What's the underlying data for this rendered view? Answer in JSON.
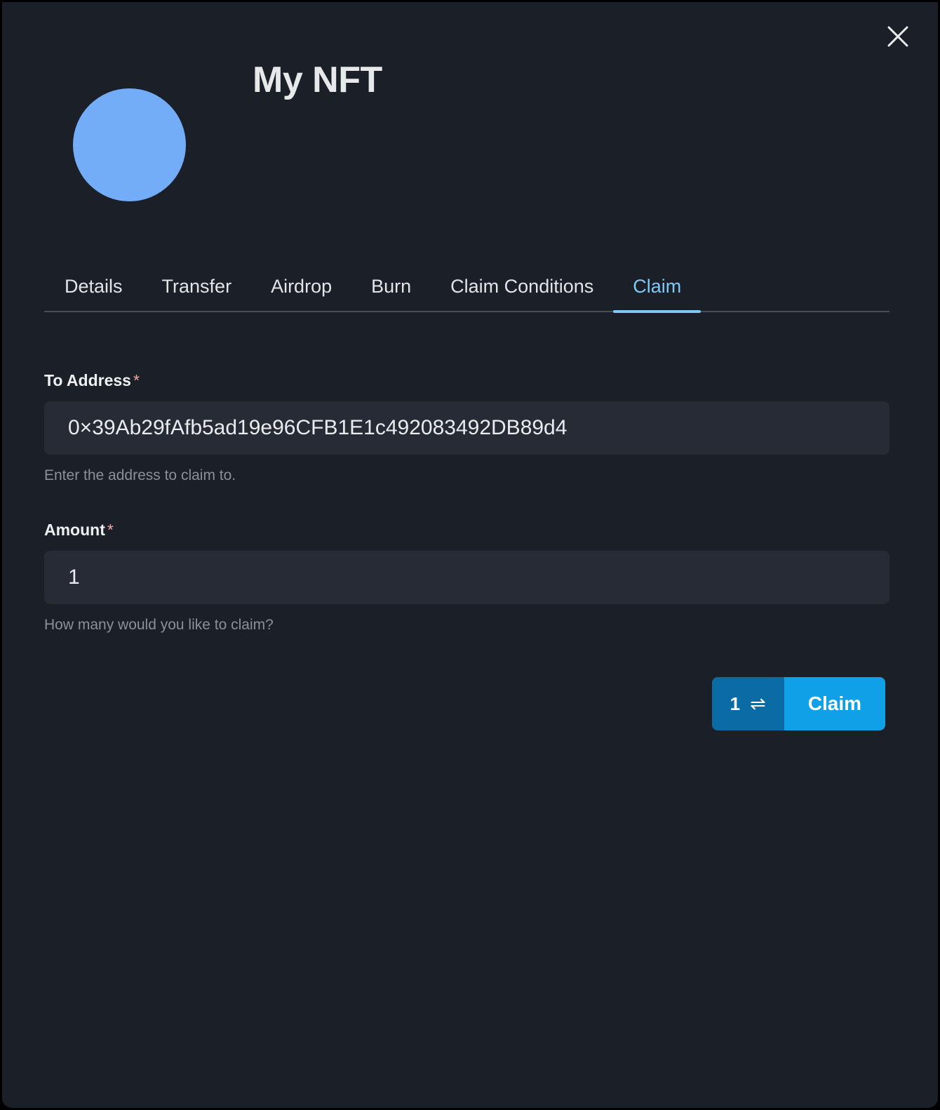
{
  "modal": {
    "title": "My NFT",
    "close_icon": "close-icon",
    "avatar_color": "#74adf7",
    "background_color": "#1b2028"
  },
  "tabs": {
    "items": [
      {
        "label": "Details",
        "active": false
      },
      {
        "label": "Transfer",
        "active": false
      },
      {
        "label": "Airdrop",
        "active": false
      },
      {
        "label": "Burn",
        "active": false
      },
      {
        "label": "Claim Conditions",
        "active": false
      },
      {
        "label": "Claim",
        "active": true
      }
    ],
    "active_color": "#7ec9f5"
  },
  "form": {
    "to_address": {
      "label": "To Address",
      "required_marker": "*",
      "value": "0×39Ab29fAfb5ad19e96CFB1E1c492083492DB89d4",
      "placeholder": "0x...",
      "helper": "Enter the address to claim to."
    },
    "amount": {
      "label": "Amount",
      "required_marker": "*",
      "value": "1",
      "placeholder": "1",
      "helper": "How many would you like to claim?"
    }
  },
  "actions": {
    "network_label": "1",
    "network_swap_icon": "⇌",
    "claim_label": "Claim",
    "network_color": "#0b6ca5",
    "claim_color": "#10a0e8"
  }
}
